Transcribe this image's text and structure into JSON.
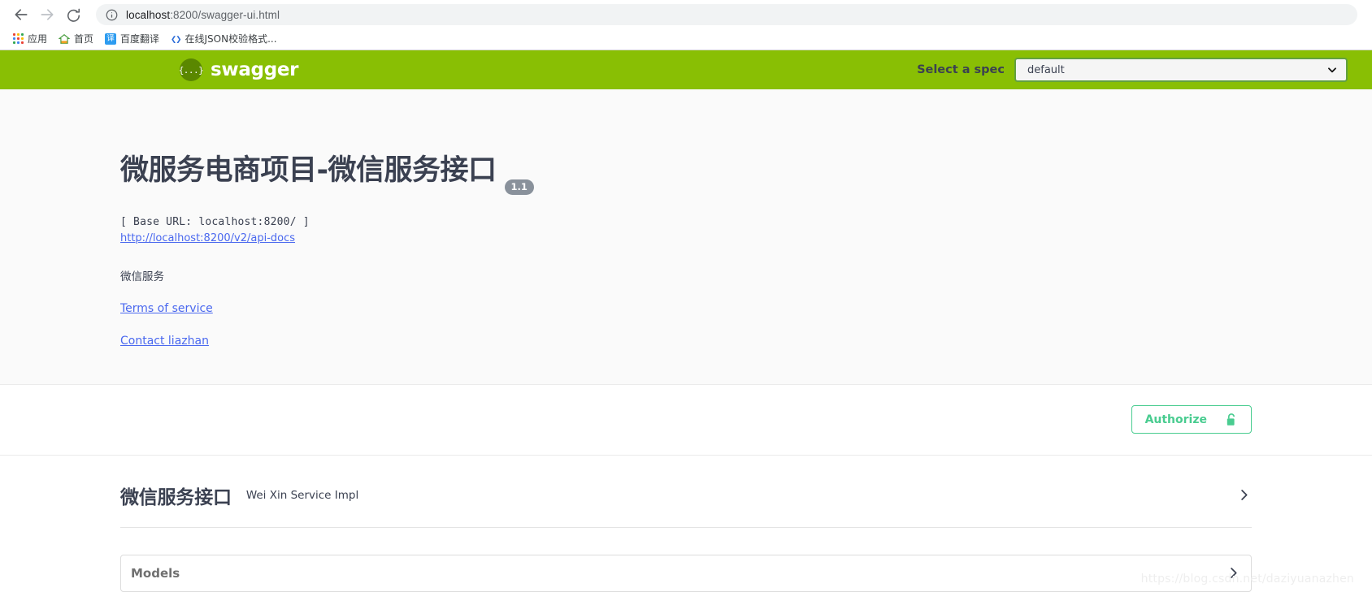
{
  "browser": {
    "back_icon": "arrow-left-icon",
    "forward_icon": "arrow-right-icon",
    "reload_icon": "reload-icon",
    "omnibox": {
      "info_icon": "info-circle-icon",
      "url_host": "localhost",
      "url_rest": ":8200/swagger-ui.html",
      "full_url": "localhost:8200/swagger-ui.html"
    },
    "bookmarks": [
      {
        "icon": "apps-grid-icon",
        "label": "应用"
      },
      {
        "icon": "home-2345-icon",
        "label": "首页"
      },
      {
        "icon": "translate-icon",
        "icon_glyph": "译",
        "label": "百度翻译"
      },
      {
        "icon": "code-brackets-icon",
        "icon_glyph": "❮❯",
        "label": "在线JSON校验格式..."
      }
    ]
  },
  "topbar": {
    "logo_mark": "{...}",
    "wordmark": "swagger",
    "spec_label": "Select a spec",
    "spec_selected": "default",
    "spec_options": [
      "default"
    ],
    "chevron_icon": "chevron-down-icon",
    "background_color": "#89bf04"
  },
  "info": {
    "title": "微服务电商项目-微信服务接口",
    "version": "1.1",
    "base_url": "[ Base URL: localhost:8200/ ]",
    "api_docs_url": "http://localhost:8200/v2/api-docs",
    "description": "微信服务",
    "terms_of_service": "Terms of service",
    "contact": "Contact liazhan"
  },
  "authorize": {
    "label": "Authorize",
    "lock_icon": "unlocked-padlock-icon",
    "accent_color": "#49cc90"
  },
  "operations": {
    "tags": [
      {
        "name": "微信服务接口",
        "description": "Wei Xin Service Impl",
        "expand_icon": "chevron-right-icon"
      }
    ],
    "models": {
      "title": "Models",
      "expand_icon": "chevron-right-icon"
    }
  },
  "watermark": "https://blog.csdn.net/daziyuanazhen"
}
